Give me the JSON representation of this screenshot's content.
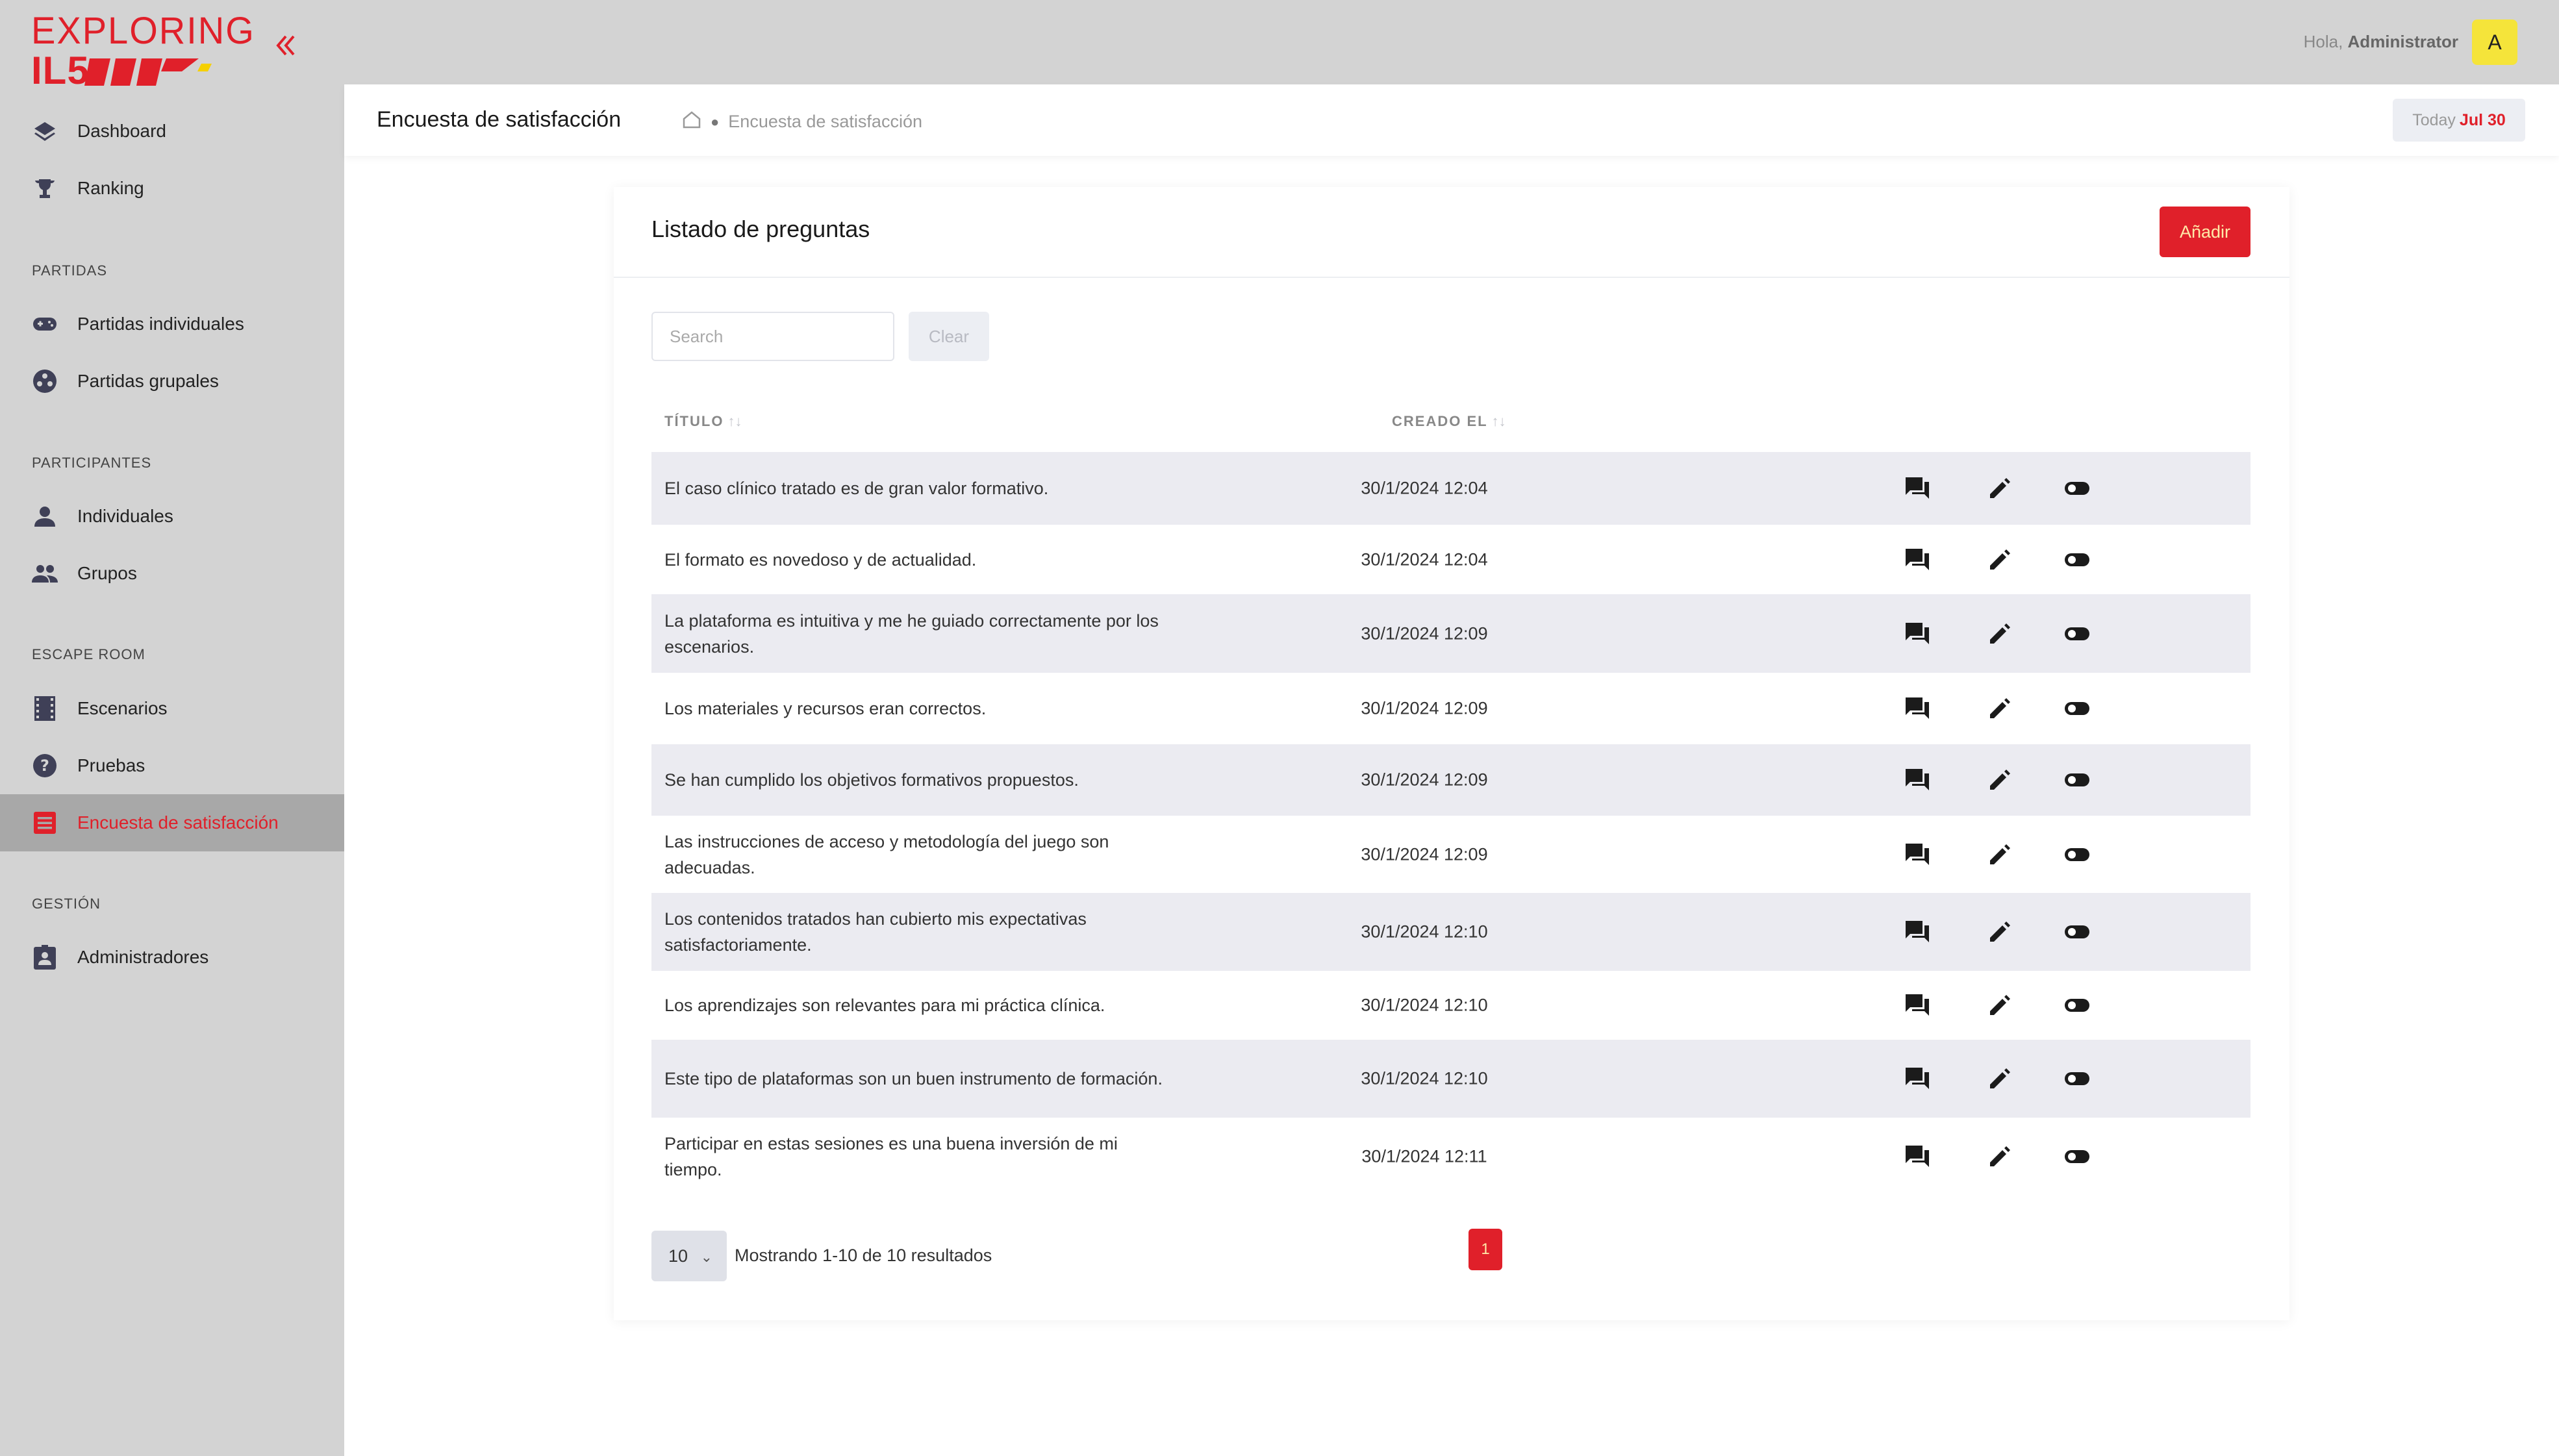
{
  "brand": {
    "logo_word": "EXPLORING",
    "logo_mark": "IL5",
    "accent_color": "#e0202a"
  },
  "sidebar": {
    "collapse_icon": "double-chevron-left-icon",
    "items": [
      {
        "label": "Dashboard",
        "icon": "layers-icon"
      },
      {
        "label": "Ranking",
        "icon": "trophy-icon"
      },
      {
        "label": "Partidas individuales",
        "icon": "gamepad-icon"
      },
      {
        "label": "Partidas grupales",
        "icon": "group-circle-icon"
      },
      {
        "label": "Individuales",
        "icon": "person-icon"
      },
      {
        "label": "Grupos",
        "icon": "people-icon"
      },
      {
        "label": "Escenarios",
        "icon": "film-icon"
      },
      {
        "label": "Pruebas",
        "icon": "help-circle-icon"
      },
      {
        "label": "Encuesta de satisfacción",
        "icon": "list-icon"
      },
      {
        "label": "Administradores",
        "icon": "badge-icon"
      }
    ],
    "sections": [
      "PARTIDAS",
      "PARTICIPANTES",
      "ESCAPE ROOM",
      "GESTIÓN"
    ]
  },
  "topbar": {
    "greeting": "Hola,",
    "user_name": "Administrator",
    "avatar_letter": "A"
  },
  "subheader": {
    "title": "Encuesta de satisfacción",
    "breadcrumb_current": "Encuesta de satisfacción",
    "today_label": "Today",
    "today_date": "Jul 30"
  },
  "card": {
    "title": "Listado de preguntas",
    "add_label": "Añadir",
    "search_placeholder": "Search",
    "clear_label": "Clear",
    "columns": {
      "title": "TÍTULO",
      "created": "CREADO EL",
      "sort_glyph": "↑↓"
    },
    "rows": [
      {
        "title": "El caso clínico tratado es de gran valor formativo.",
        "created": "30/1/2024 12:04"
      },
      {
        "title": "El formato es novedoso y de actualidad.",
        "created": "30/1/2024 12:04"
      },
      {
        "title": "La plataforma es intuitiva y me he guiado correctamente por los escenarios.",
        "created": "30/1/2024 12:09"
      },
      {
        "title": "Los materiales y recursos eran correctos.",
        "created": "30/1/2024 12:09"
      },
      {
        "title": "Se han cumplido los objetivos formativos propuestos.",
        "created": "30/1/2024 12:09"
      },
      {
        "title": "Las instrucciones de acceso y metodología del juego son adecuadas.",
        "created": "30/1/2024 12:09"
      },
      {
        "title": "Los contenidos tratados han cubierto mis expectativas satisfactoriamente.",
        "created": "30/1/2024 12:10"
      },
      {
        "title": "Los aprendizajes son relevantes para mi práctica clínica.",
        "created": "30/1/2024 12:10"
      },
      {
        "title": "Este tipo de plataformas son un buen instrumento de formación.",
        "created": "30/1/2024 12:10"
      },
      {
        "title": "Participar en estas sesiones es una buena inversión de mi tiempo.",
        "created": "30/1/2024 12:11"
      }
    ],
    "row_actions": [
      "comments-icon",
      "edit-pencil-icon",
      "toggle-switch-icon"
    ],
    "pagination": {
      "page_size": "10",
      "info": "Mostrando 1-10 de 10 resultados",
      "current_page": "1"
    }
  }
}
